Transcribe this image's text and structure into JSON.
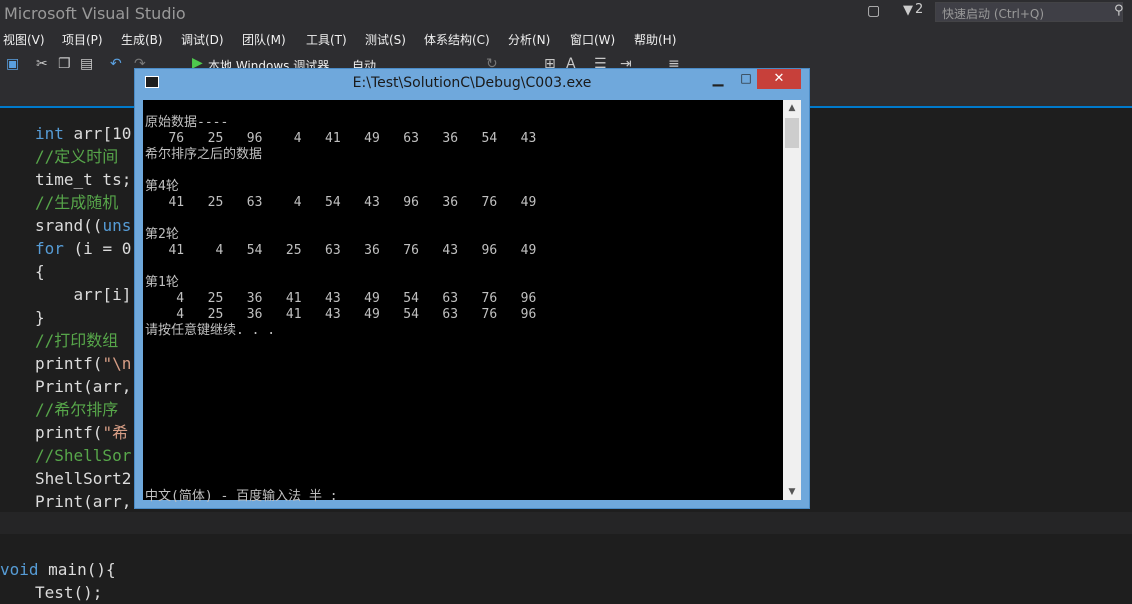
{
  "vs": {
    "title": "Microsoft Visual Studio",
    "filter_count": "2",
    "quick_launch_placeholder": "快速启动 (Ctrl+Q)",
    "menu": [
      "视图(V)",
      "项目(P)",
      "生成(B)",
      "调试(D)",
      "团队(M)",
      "工具(T)",
      "测试(S)",
      "体系结构(C)",
      "分析(N)",
      "窗口(W)",
      "帮助(H)"
    ],
    "toolbar": {
      "run_label": "本地 Windows 调试器",
      "config_label": "自动"
    }
  },
  "editor": {
    "lines": [
      {
        "kw": "int",
        "rest": " arr[10"
      },
      {
        "cm": "//定义时间"
      },
      {
        "rest": "time_t ts;"
      },
      {
        "cm": "//生成随机"
      },
      {
        "rest": "srand((",
        "kw2": "uns"
      },
      {
        "kw": "for",
        "rest": " (i = 0"
      },
      {
        "rest": "{"
      },
      {
        "rest": "    arr[i]"
      },
      {
        "rest": "}"
      },
      {
        "cm": "//打印数组"
      },
      {
        "rest": "printf(",
        "st": "\"\\n"
      },
      {
        "rest": "Print(arr,"
      },
      {
        "cm": "//希尔排序"
      },
      {
        "rest": "printf(",
        "st": "\"希"
      },
      {
        "cm": "//ShellSor"
      },
      {
        "rest": "ShellSort2"
      },
      {
        "rest": "Print(arr,"
      }
    ],
    "main_kw": "void",
    "main_rest": " main(){",
    "test_call": "Test();"
  },
  "console": {
    "title": "E:\\Test\\SolutionC\\Debug\\C003.exe",
    "minimize": "▁",
    "maximize": "□",
    "close": "✕",
    "output": "原始数据----\n   76   25   96    4   41   49   63   36   54   43\n希尔排序之后的数据\n\n第4轮\n   41   25   63    4   54   43   96   36   76   49\n\n第2轮\n   41    4   54   25   63   36   76   43   96   49\n\n第1轮\n    4   25   36   41   43   49   54   63   76   96\n    4   25   36   41   43   49   54   63   76   96\n请按任意键继续. . .",
    "ime_status": "中文(简体) - 百度输入法 半 :"
  },
  "icons": {
    "notification": "notification-icon",
    "filter": "filter-icon",
    "search": "search-icon"
  }
}
